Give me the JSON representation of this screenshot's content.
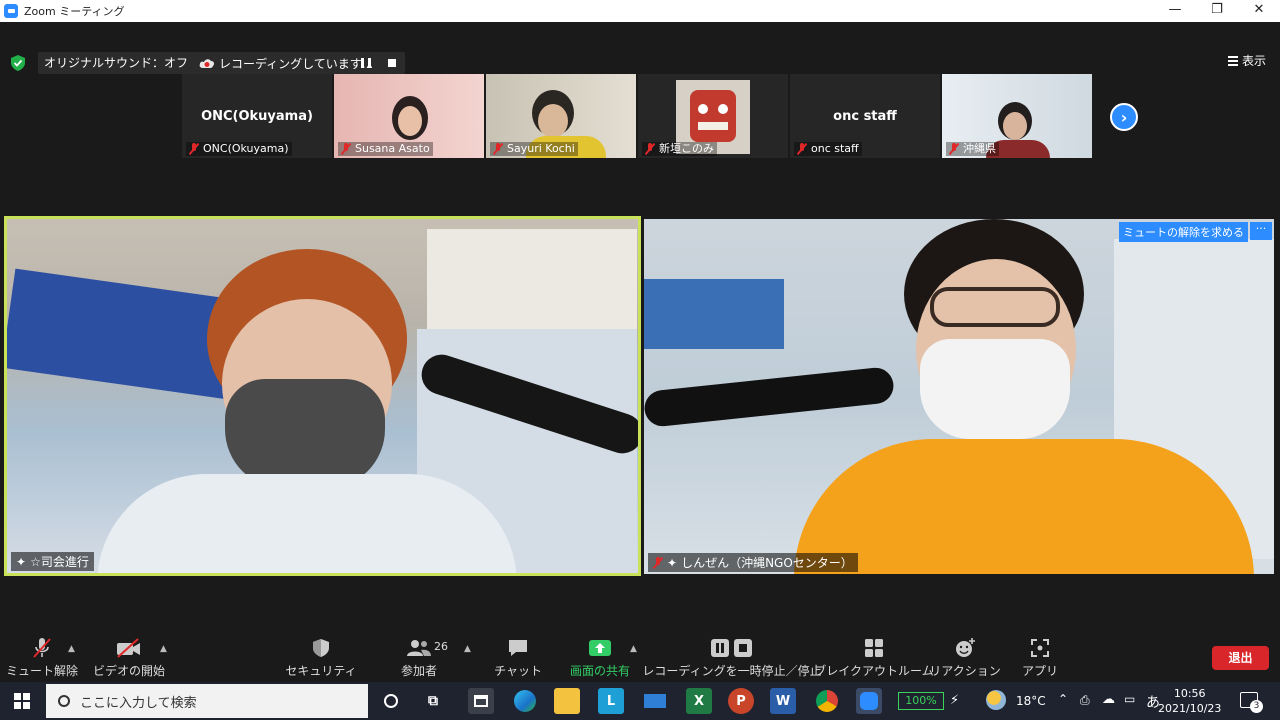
{
  "window": {
    "title": "Zoom ミーティング",
    "min": "—",
    "restore": "❐",
    "close": "✕"
  },
  "topbar": {
    "audio_label": "オリジナルサウンド：オフ",
    "recording_label": "レコーディングしています...",
    "view_label": "表示"
  },
  "thumbnails": [
    {
      "name": "ONC(Okuyama)",
      "big_name": "ONC(Okuyama)",
      "video": false
    },
    {
      "name": "Susana Asato",
      "big_name": "",
      "video": true
    },
    {
      "name": "Sayuri Kochi",
      "big_name": "",
      "video": true
    },
    {
      "name": "新垣このみ",
      "big_name": "",
      "video": true
    },
    {
      "name": "onc staff",
      "big_name": "onc staff",
      "video": false
    },
    {
      "name": "沖縄県",
      "big_name": "",
      "video": true
    }
  ],
  "main_tiles": {
    "left_name": "☆司会進行",
    "right_name": "しんぜん（沖縄NGOセンター）",
    "unmute_request": "ミュートの解除を求める",
    "more": "···"
  },
  "toolbar": {
    "mute": "ミュート解除",
    "video": "ビデオの開始",
    "security": "セキュリティ",
    "participants": "参加者",
    "participants_count": "26",
    "chat": "チャット",
    "share": "画面の共有",
    "record": "レコーディングを一時停止／停止",
    "breakout": "ブレイクアウトルーム",
    "reaction": "リアクション",
    "apps": "アプリ",
    "exit": "退出"
  },
  "taskbar": {
    "search_placeholder": "ここに入力して検索",
    "battery": "100%",
    "temperature": "18°C",
    "ime": "あ",
    "time": "10:56",
    "date": "2021/10/23",
    "notifications": "3"
  },
  "colors": {
    "accent": "#2d8cff",
    "active_speaker": "#c9e25a",
    "share_green": "#33cc66",
    "exit_red": "#d9262b",
    "muted_red": "#e02828"
  }
}
